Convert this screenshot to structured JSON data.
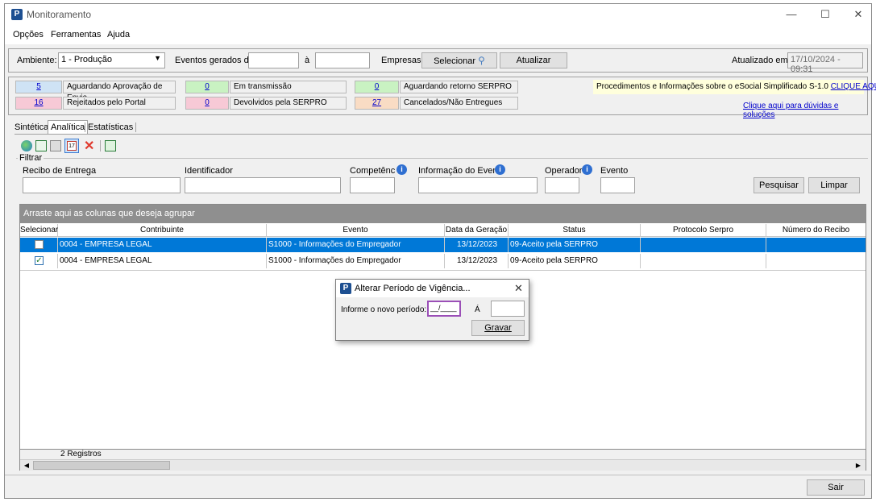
{
  "window": {
    "title": "Monitoramento",
    "app_icon_letter": "P"
  },
  "menu": [
    "Opções",
    "Ferramentas",
    "Ajuda"
  ],
  "toolbar": {
    "ambiente_label": "Ambiente:",
    "ambiente_value": "1 - Produção",
    "eventos_label": "Eventos gerados de:",
    "a_label": "à",
    "empresas_label": "Empresas:",
    "selecionar_label": "Selecionar",
    "atualizar_label": "Atualizar",
    "atualizado_label": "Atualizado em:",
    "atualizado_value": "17/10/2024 - 09:31"
  },
  "status_cards": [
    {
      "count": "5",
      "label": "Aguardando Aprovação de Envio",
      "color": "#cfe3f5"
    },
    {
      "count": "0",
      "label": "Em transmissão",
      "color": "#c9f2c2"
    },
    {
      "count": "0",
      "label": "Aguardando retorno SERPRO",
      "color": "#c9f2c2"
    },
    {
      "count": "16",
      "label": "Rejeitados pelo Portal",
      "color": "#f7c9d6"
    },
    {
      "count": "0",
      "label": "Devolvidos pela SERPRO",
      "color": "#f7c9d6"
    },
    {
      "count": "27",
      "label": "Cancelados/Não Entregues",
      "color": "#f9dcc4"
    }
  ],
  "info": {
    "procedimentos_text": "Procedimentos e Informações sobre o eSocial Simplificado S-1.0",
    "clique_aqui": "CLIQUE AQUI",
    "duvidas_link": "Clique aqui para dúvidas e soluções"
  },
  "tabs": [
    "Sintética",
    "Analítica",
    "Estatísticas"
  ],
  "active_tab": "Analítica",
  "filter": {
    "group_label": "Filtrar",
    "recibo_label": "Recibo de Entrega",
    "identificador_label": "Identificador",
    "competencia_label": "Competênc",
    "informacao_label": "Informação do Evento",
    "operador_label": "Operador",
    "evento_label": "Evento",
    "pesquisar_label": "Pesquisar",
    "limpar_label": "Limpar"
  },
  "grid": {
    "group_hint": "Arraste aqui as colunas que deseja agrupar",
    "columns": [
      "Selecionar",
      "Contribuinte",
      "Evento",
      "Data da Geração",
      "Status",
      "Protocolo Serpro",
      "Número do Recibo"
    ],
    "rows": [
      {
        "selected": false,
        "highlighted": true,
        "contribuinte": "0004 - EMPRESA LEGAL",
        "evento": "S1000 - Informações do Empregador",
        "data": "13/12/2023",
        "status": "09-Aceito pela SERPRO",
        "protocolo": "",
        "recibo": ""
      },
      {
        "selected": true,
        "highlighted": false,
        "contribuinte": "0004 - EMPRESA LEGAL",
        "evento": "S1000 - Informações do Empregador",
        "data": "13/12/2023",
        "status": "09-Aceito pela SERPRO",
        "protocolo": "",
        "recibo": ""
      }
    ],
    "footer_count": "2 Registros"
  },
  "dialog": {
    "title": "Alterar Período de Vigência...",
    "prompt": "Informe o novo período:",
    "start_value": "__/____",
    "a_label": "Á",
    "end_value": "",
    "gravar_label": "Gravar"
  },
  "sair_label": "Sair",
  "colors": {
    "selection": "#0078d7",
    "group_header": "#8f8f8f",
    "link": "#0000cc"
  }
}
